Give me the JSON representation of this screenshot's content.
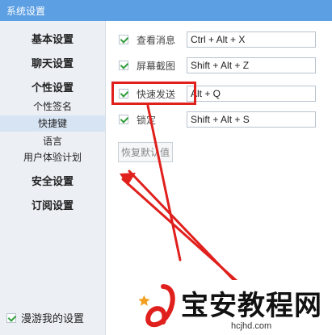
{
  "window": {
    "title": "系统设置"
  },
  "sidebar": {
    "items": [
      {
        "label": "基本设置"
      },
      {
        "label": "聊天设置"
      },
      {
        "label": "个性设置"
      },
      {
        "label": "个性签名"
      },
      {
        "label": "快捷键"
      },
      {
        "label": "语言"
      },
      {
        "label": "用户体验计划"
      },
      {
        "label": "安全设置"
      },
      {
        "label": "订阅设置"
      }
    ],
    "roaming": {
      "label": "漫游我的设置",
      "checked": true
    }
  },
  "shortcuts": [
    {
      "label": "查看消息",
      "value": "Ctrl + Alt + X",
      "checked": true
    },
    {
      "label": "屏幕截图",
      "value": "Shift + Alt + Z",
      "checked": true
    },
    {
      "label": "快速发送",
      "value": "Alt + Q",
      "checked": true
    },
    {
      "label": "锁定",
      "value": "Shift + Alt + S",
      "checked": true
    }
  ],
  "restore_label": "恢复默认值",
  "watermark": {
    "text": "宝安教程网",
    "url": "hcjhd.com"
  },
  "colors": {
    "titlebar": "#5c9fe3",
    "highlight": "#e0201d",
    "check": "#2e9e3a"
  }
}
